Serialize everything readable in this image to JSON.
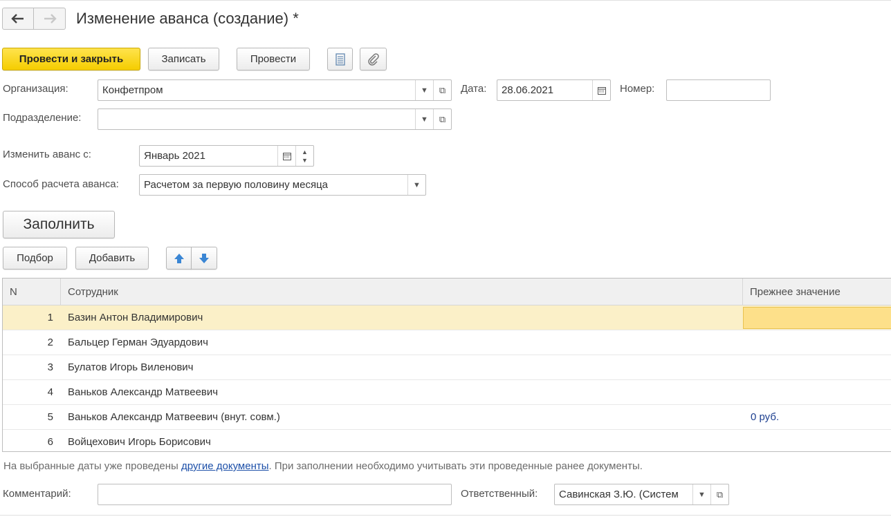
{
  "window": {
    "title": "Изменение аванса (создание) *",
    "back_symbol": "🡐",
    "forward_symbol": "🡒"
  },
  "toolbar": {
    "post_close_label": "Провести и закрыть",
    "save_label": "Записать",
    "post_label": "Провести",
    "list_icon": "list-icon",
    "attach_icon": "paperclip-icon"
  },
  "form": {
    "organization_label": "Организация:",
    "organization_value": "Конфетпром",
    "date_label": "Дата:",
    "date_value": "28.06.2021",
    "number_label": "Номер:",
    "number_value": "",
    "department_label": "Подразделение:",
    "department_value": "",
    "change_from_label": "Изменить аванс с:",
    "change_from_value": "Январь 2021",
    "method_label": "Способ расчета аванса:",
    "method_value": "Расчетом за первую половину месяца"
  },
  "actions": {
    "fill_label": "Заполнить",
    "pick_label": "Подбор",
    "add_label": "Добавить"
  },
  "table": {
    "columns": [
      "N",
      "Сотрудник",
      "Прежнее значение"
    ],
    "rows": [
      {
        "n": "1",
        "employee": "Базин Антон Владимирович",
        "previous": ""
      },
      {
        "n": "2",
        "employee": "Бальцер Герман Эдуардович",
        "previous": ""
      },
      {
        "n": "3",
        "employee": "Булатов Игорь Виленович",
        "previous": ""
      },
      {
        "n": "4",
        "employee": "Ваньков Александр Матвеевич",
        "previous": ""
      },
      {
        "n": "5",
        "employee": "Ваньков Александр Матвеевич (внут. совм.)",
        "previous": "0 руб."
      },
      {
        "n": "6",
        "employee": "Войцехович Игорь Борисович",
        "previous": ""
      }
    ]
  },
  "info": {
    "before": "На выбранные даты уже проведены ",
    "link": "другие документы",
    "after": ". При заполнении необходимо учитывать эти проведенные ранее документы."
  },
  "footer": {
    "comment_label": "Комментарий:",
    "comment_value": "",
    "responsible_label": "Ответственный:",
    "responsible_value": "Савинская З.Ю. (Систем"
  },
  "colors": {
    "primary_button": "#f5cd00",
    "selected_row": "#fbf0c8",
    "link": "#1c4fa8"
  }
}
